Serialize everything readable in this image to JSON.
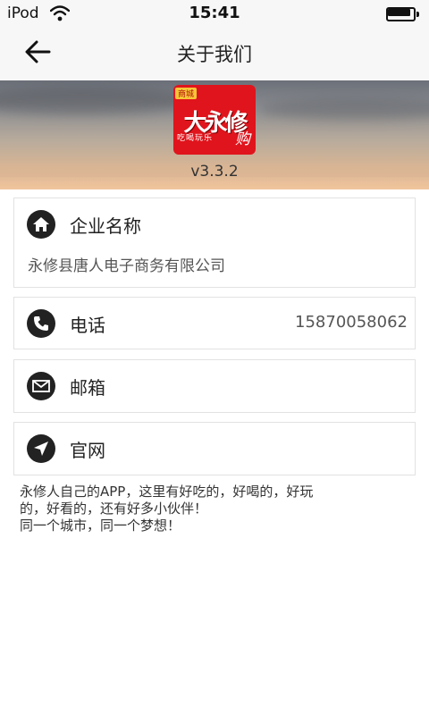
{
  "status_bar": {
    "carrier": "iPod",
    "time": "15:41",
    "battery_level": 0.85
  },
  "nav": {
    "title": "关于我们",
    "back_icon": "arrow-left-icon"
  },
  "app": {
    "logo_tag": "商城",
    "logo_main": "大永修",
    "logo_subtitle": "吃喝玩乐",
    "logo_suffix": "购",
    "version": "v3.3.2"
  },
  "company": {
    "label": "企业名称",
    "icon": "home-icon",
    "value": "永修县唐人电子商务有限公司"
  },
  "phone": {
    "label": "电话",
    "icon": "phone-icon",
    "value": "15870058062"
  },
  "email": {
    "label": "邮箱",
    "icon": "mail-icon"
  },
  "website": {
    "label": "官网",
    "icon": "navigation-icon"
  },
  "intro_text": "永修人自己的APP，这里有好吃的，好喝的，好玩\n的，好看的，还有好多小伙伴！\n同一个城市，同一个梦想！",
  "colors": {
    "logo_red": "#e0141c",
    "icon_dark": "#222222",
    "bar_bg": "#f7f7f7"
  }
}
